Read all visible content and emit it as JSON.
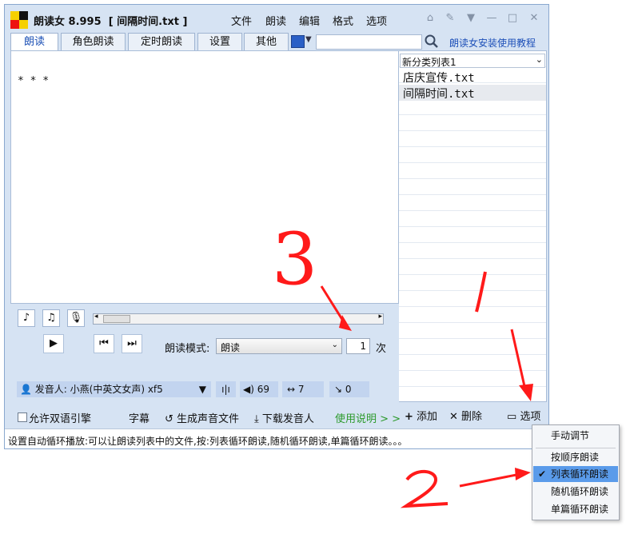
{
  "app": {
    "title": "朗读女 8.995  [ 间隔时间.txt ]"
  },
  "menubar": [
    "文件",
    "朗读",
    "编辑",
    "格式",
    "选项"
  ],
  "tabs": [
    "朗读",
    "角色朗读",
    "定时朗读",
    "设置",
    "其他"
  ],
  "toolbar": {
    "help_link": "朗读女安装使用教程"
  },
  "editor": {
    "content": "* * *"
  },
  "sidebar": {
    "list_name": "新分类列表1",
    "files": [
      "店庆宣传.txt",
      "间隔时间.txt"
    ],
    "add": "添加",
    "delete": "删除",
    "options": "选项"
  },
  "controls": {
    "mode_label": "朗读模式:",
    "mode_value": "朗读",
    "repeat": "1",
    "repeat_unit": "次",
    "speaker_label": "发音人:",
    "speaker_value": "小燕(中英文女声) xf5",
    "volume": "69",
    "speed": "7",
    "pitch": "0",
    "bilingual": "允许双语引擎",
    "subtitle": "字幕",
    "generate": "生成声音文件",
    "download": "下载发音人",
    "usage": "使用说明 > >"
  },
  "status": "设置自动循环播放:可以让朗读列表中的文件,按:列表循环朗读,随机循环朗读,单篇循环朗读。。。",
  "context_menu": {
    "items": [
      "手动调节",
      "按顺序朗读",
      "列表循环朗读",
      "随机循环朗读",
      "单篇循环朗读"
    ],
    "selected": "列表循环朗读"
  },
  "annotations": [
    "3",
    "1",
    "2"
  ],
  "colors": {
    "accent": "#1c4fb8",
    "annotation": "#ff1a1a",
    "highlight": "#5a9bea"
  }
}
